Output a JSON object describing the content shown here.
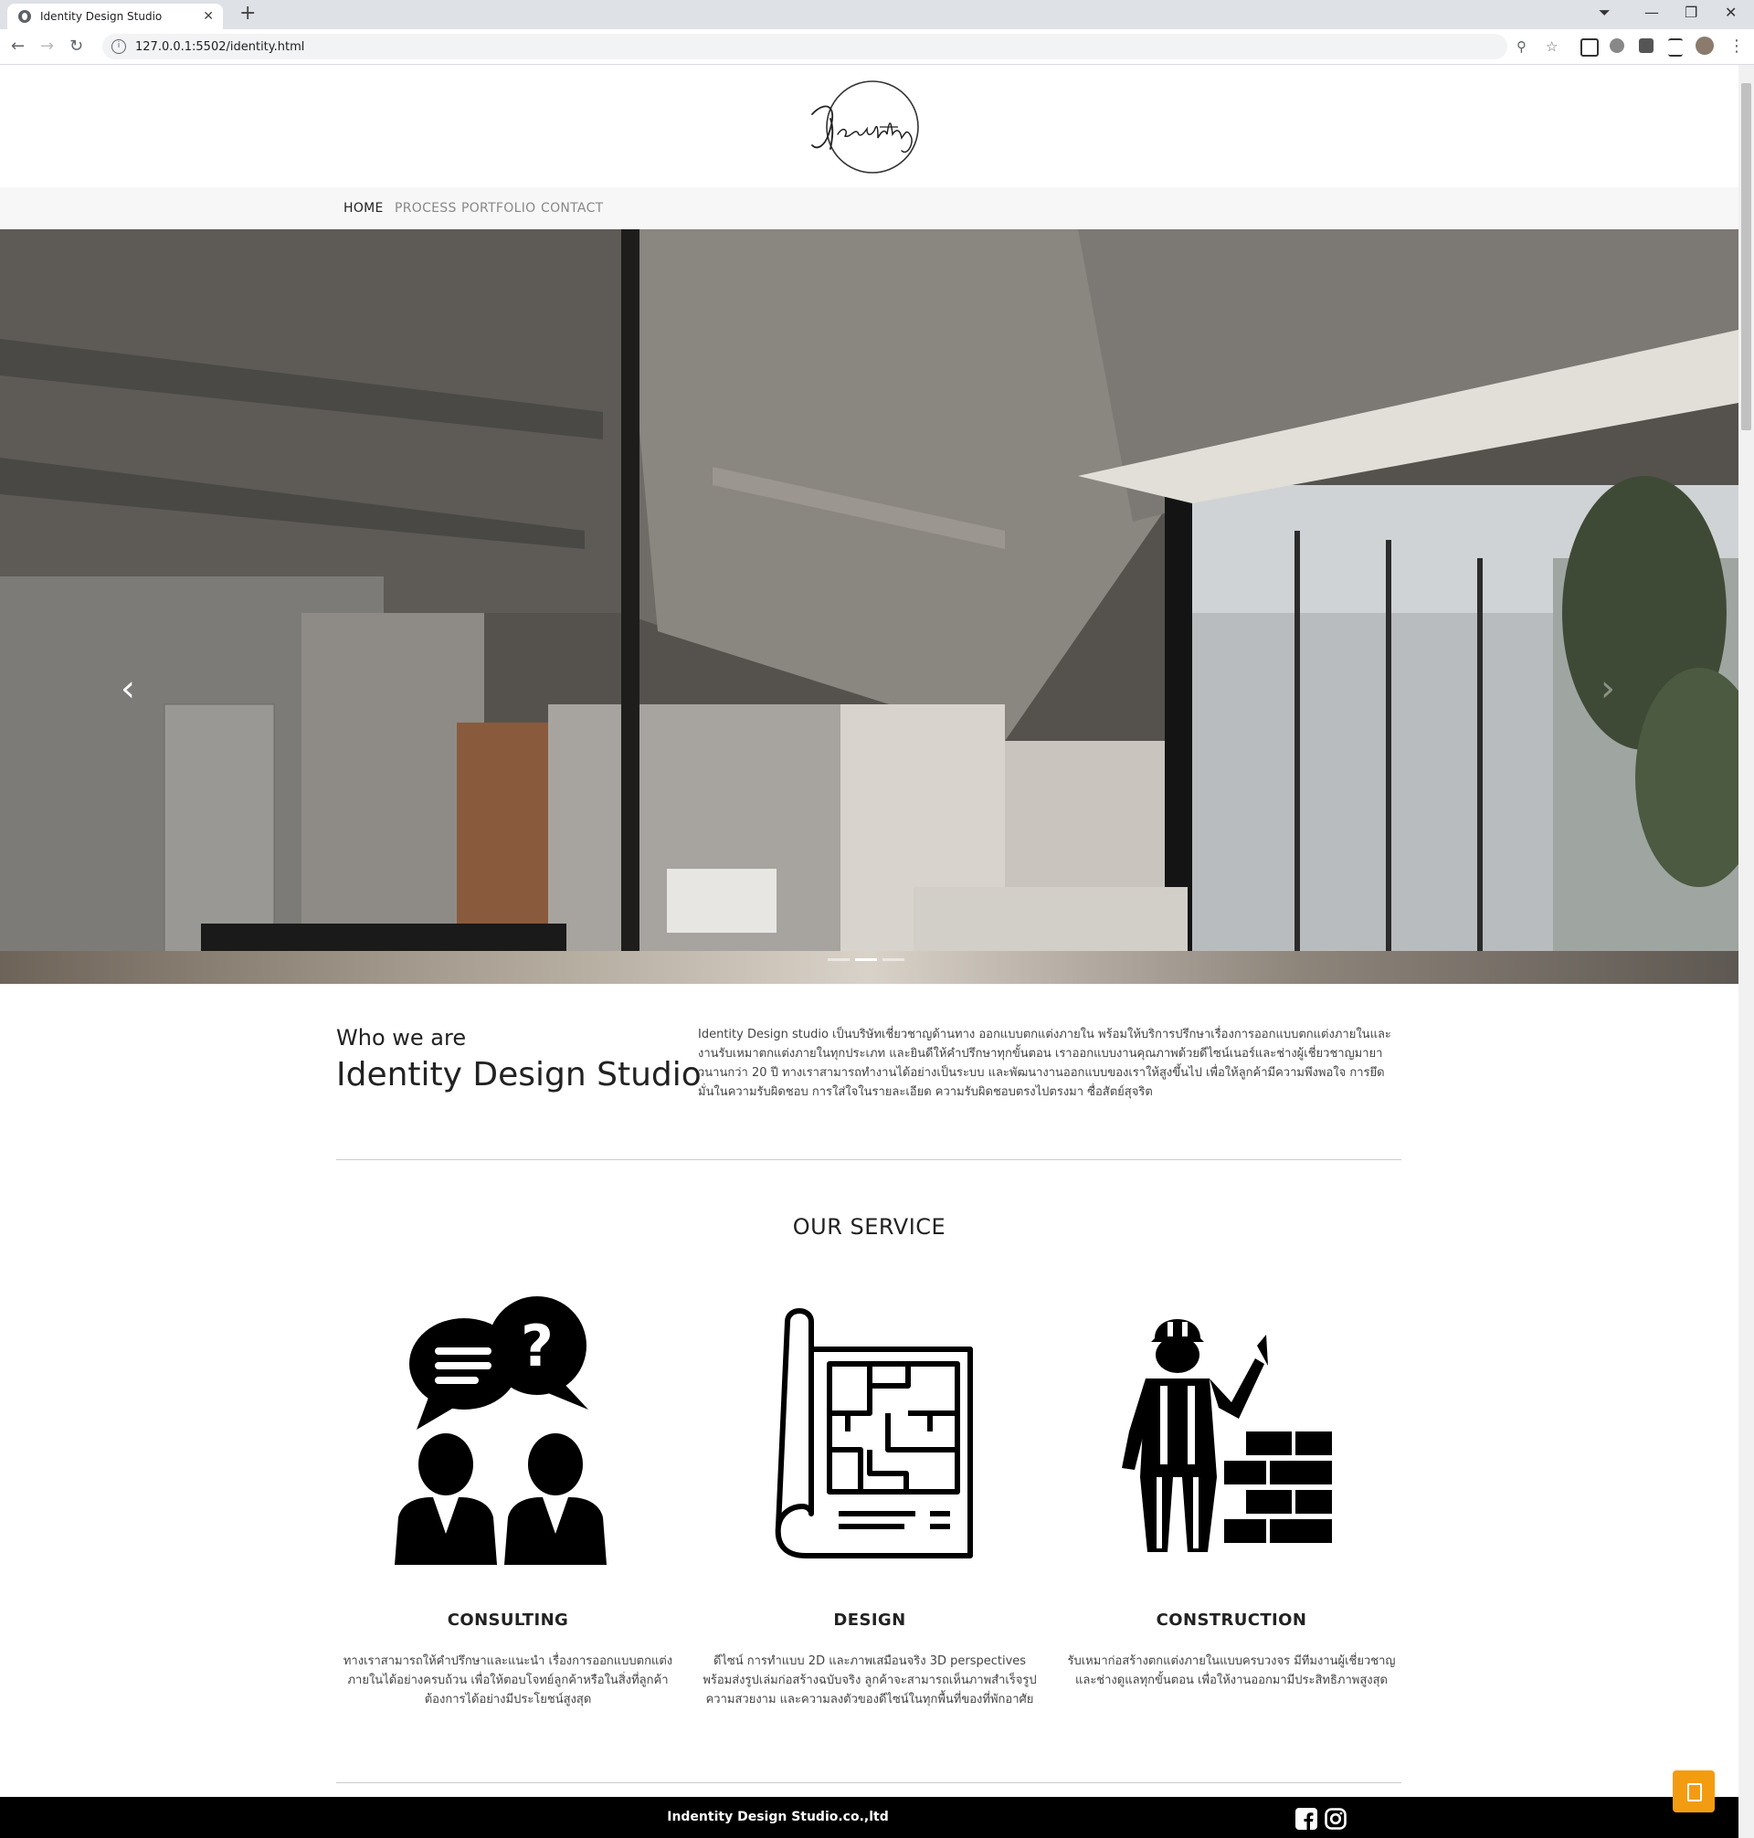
{
  "browser": {
    "tab_title": "Identity Design Studio",
    "url": "127.0.0.1:5502/identity.html"
  },
  "site": {
    "nav": [
      {
        "label": "HOME",
        "active": true
      },
      {
        "label": "PROCESS",
        "active": false
      },
      {
        "label": "PORTFOLIO",
        "active": false
      },
      {
        "label": "CONTACT",
        "active": false
      }
    ],
    "hero": {
      "prev": "‹",
      "next": "›",
      "slides": 3,
      "active_slide": 2
    },
    "about": {
      "kicker": "Who we are",
      "title": "Identity Design Studio",
      "description": "Identity Design studio เป็นบริษัทเชี่ยวชาญด้านทาง ออกแบบตกแต่งภายใน พร้อมให้บริการปรึกษาเรื่องการออกแบบตกแต่งภายในและงานรับเหมาตกแต่งภายในทุกประเภท และยินดีให้คำปรึกษาทุกขั้นตอน เราออกแบบงานคุณภาพด้วยดีไซน์เนอร์และช่างผู้เชี่ยวชาญมายาวนานกว่า 20 ปี ทางเราสามารถทำงานได้อย่างเป็นระบบ และพัฒนางานออกแบบของเราให้สูงขึ้นไป เพื่อให้ลูกค้ามีความพึงพอใจ การยึดมั่นในความรับผิดชอบ การใส่ใจในรายละเอียด ความรับผิดชอบตรงไปตรงมา ซื่อสัตย์สุจริต"
    },
    "services": {
      "title": "OUR SERVICE",
      "items": [
        {
          "name": "CONSULTING",
          "icon": "consulting-icon",
          "text": "ทางเราสามารถให้คำปรึกษาและแนะนำ เรื่องการออกแบบตกแต่งภายในได้อย่างครบถ้วน เพื่อให้ตอบโจทย์ลูกค้าหรือในสิ่งที่ลูกค้าต้องการได้อย่างมีประโยชน์สูงสุด"
        },
        {
          "name": "DESIGN",
          "icon": "blueprint-icon",
          "text": "ดีไซน์ การทำแบบ 2D และภาพเสมือนจริง 3D perspectives พร้อมส่งรูปเล่มก่อสร้างฉบับจริง ลูกค้าจะสามารถเห็นภาพสำเร็จรูป ความสวยงาม และความลงตัวของดีไซน์ในทุกพื้นที่ของที่พักอาศัย"
        },
        {
          "name": "CONSTRUCTION",
          "icon": "construction-worker-icon",
          "text": "รับเหมาก่อสร้างตกแต่งภายในแบบครบวงจร มีทีมงานผู้เชี่ยวชาญและช่างดูแลทุกขั้นตอน เพื่อให้งานออกมามีประสิทธิภาพสูงสุด"
        }
      ]
    },
    "footer": {
      "company": "Indentity Design Studio.co.,ltd"
    },
    "colors": {
      "accent": "#f39c12",
      "footer": "#000000",
      "menu_bg": "#f7f7f7"
    }
  }
}
